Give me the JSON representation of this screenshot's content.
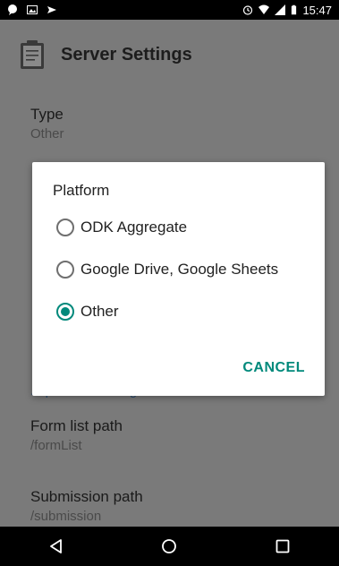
{
  "status_bar": {
    "time": "15:47",
    "icons": [
      "chat-bubble-icon",
      "image-icon",
      "share-icon",
      "alarm-icon",
      "wifi-icon",
      "signal-icon",
      "battery-icon"
    ]
  },
  "app_bar": {
    "title": "Server Settings",
    "icon": "clipboard-icon"
  },
  "preferences": {
    "type": {
      "title": "Type",
      "summary": "Other"
    },
    "partial_link": "... platform settings",
    "form_list_path": {
      "title": "Form list path",
      "summary": "/formList"
    },
    "submission_path": {
      "title": "Submission path",
      "summary": "/submission"
    }
  },
  "dialog": {
    "title": "Platform",
    "options": [
      {
        "label": "ODK Aggregate",
        "selected": false
      },
      {
        "label": "Google Drive, Google Sheets",
        "selected": false
      },
      {
        "label": "Other",
        "selected": true
      }
    ],
    "cancel_label": "CANCEL",
    "accent_color": "#00897b"
  },
  "nav_bar": {
    "buttons": [
      "back-icon",
      "home-icon",
      "recents-icon"
    ]
  }
}
